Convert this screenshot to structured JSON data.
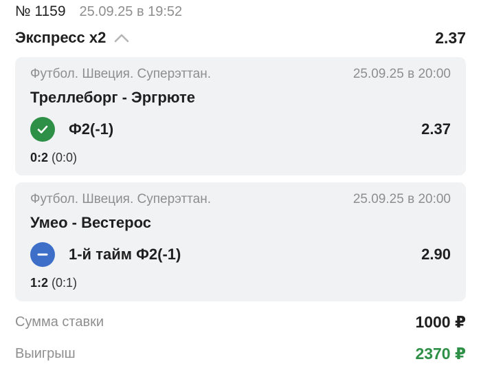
{
  "header": {
    "bet_number": "№ 1159",
    "bet_datetime": "25.09.25 в 19:52"
  },
  "express": {
    "title": "Экспресс х2",
    "coefficient": "2.37",
    "chevron_icon": "chevron-up-icon"
  },
  "events": [
    {
      "category": "Футбол. Швеция. Суперэттан.",
      "datetime": "25.09.25 в 20:00",
      "teams": "Треллеборг - Эргрюте",
      "status_icon": "check-circle-icon",
      "status_color": "#2e8f47",
      "outcome": "Ф2(-1)",
      "coefficient": "2.37",
      "score": "0:2",
      "half_score": "(0:0)"
    },
    {
      "category": "Футбол. Швеция. Суперэттан.",
      "datetime": "25.09.25 в 20:00",
      "teams": "Умео - Вестерос",
      "status_icon": "minus-circle-icon",
      "status_color": "#3d6fc9",
      "outcome": "1-й тайм Ф2(-1)",
      "coefficient": "2.90",
      "score": "1:2",
      "half_score": "(0:1)"
    }
  ],
  "summary": {
    "stake_label": "Сумма ставки",
    "stake_value": "1000 ₽",
    "win_label": "Выигрыш",
    "win_value": "2370 ₽",
    "win_color": "#2e8f47"
  }
}
